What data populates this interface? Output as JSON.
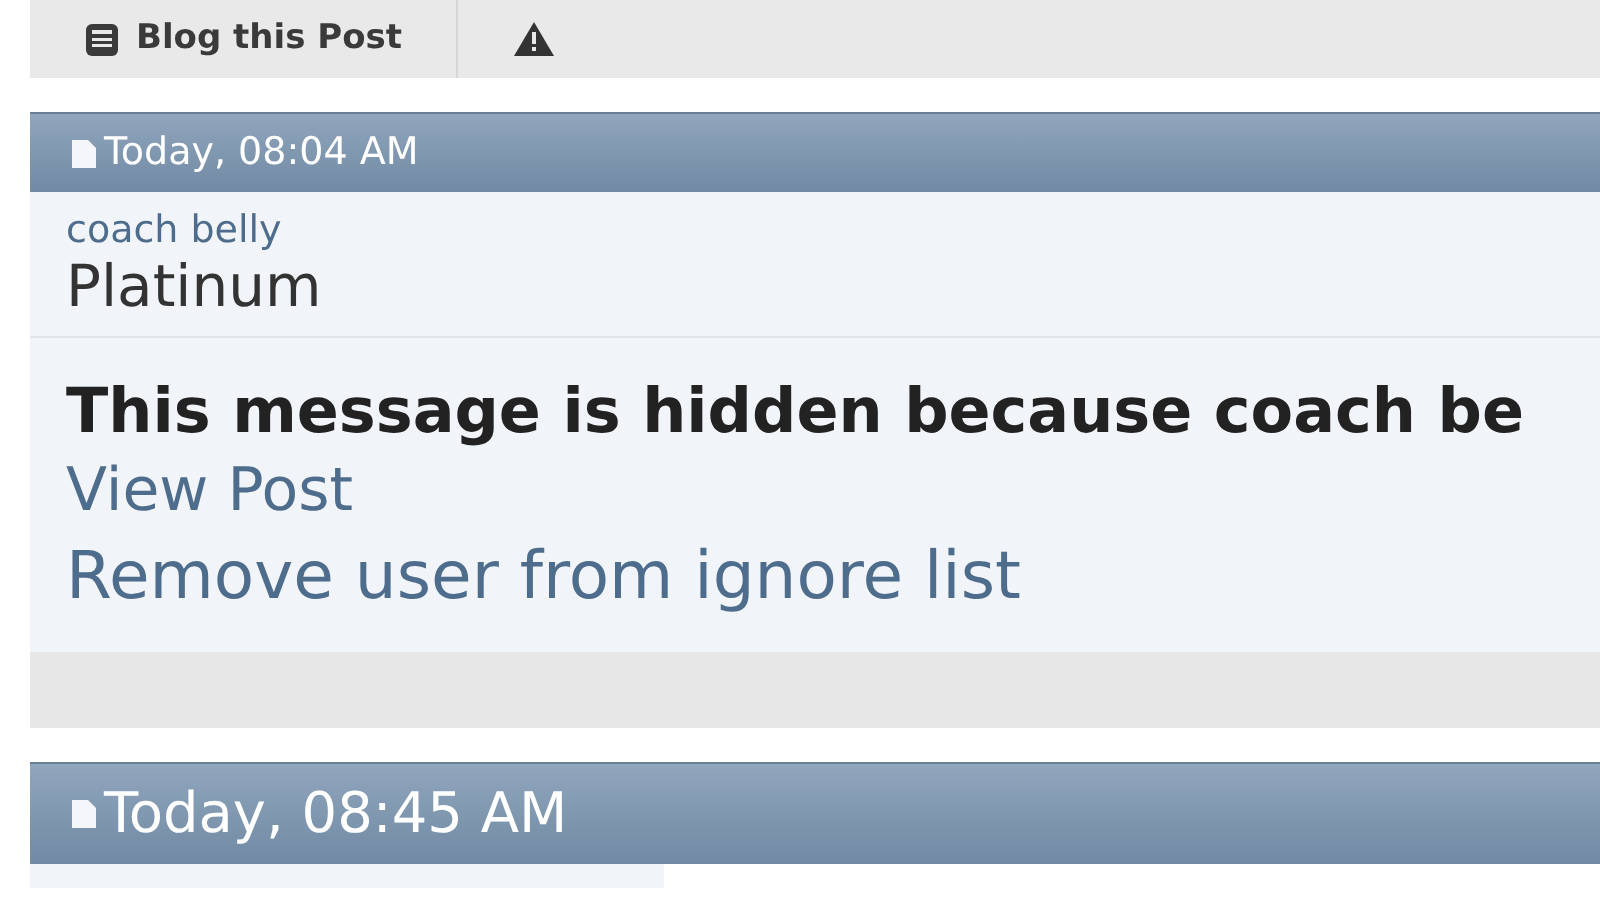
{
  "toolbar": {
    "buttons": [
      {
        "label": "Blog this Post",
        "kind": "blog"
      },
      {
        "kind": "report"
      }
    ]
  },
  "posts": [
    {
      "date": "Today, 08:04 AM",
      "username": "coach belly",
      "rank": "Platinum",
      "hidden_message": "This message is hidden because coach be",
      "links": [
        "View Post",
        "Remove user from ignore list"
      ]
    },
    {
      "date": "Today, 08:45 AM"
    }
  ]
}
